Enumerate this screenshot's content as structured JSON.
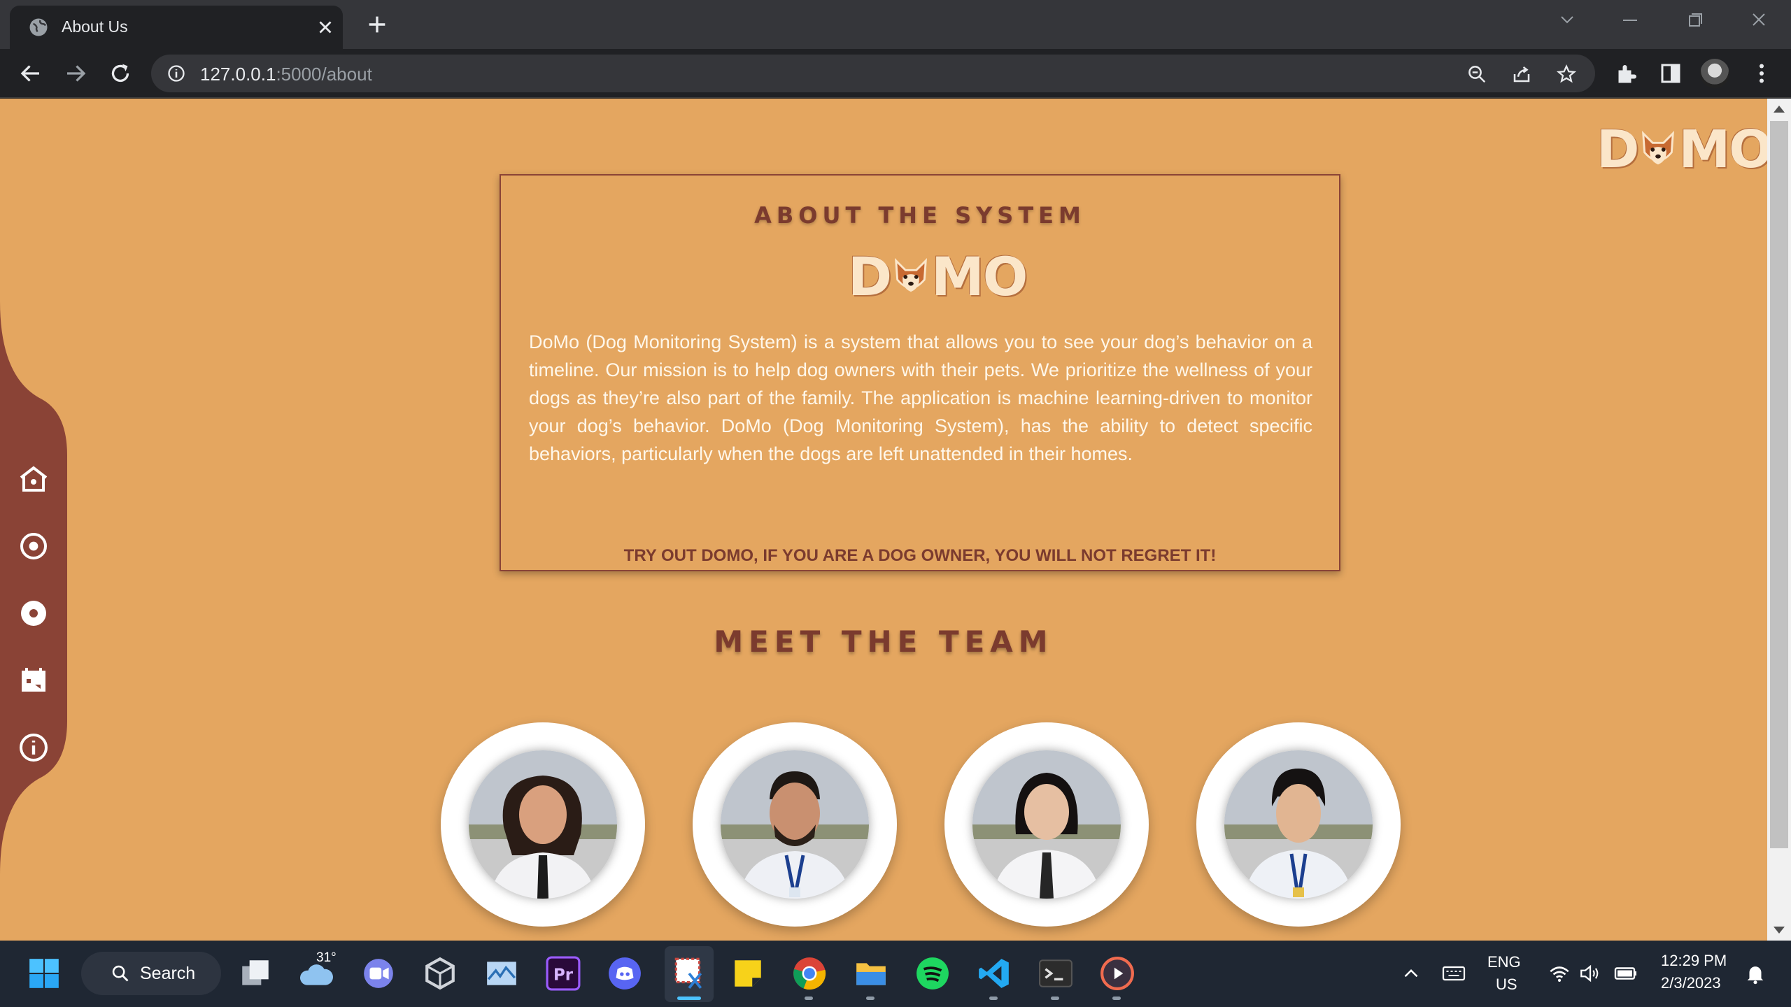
{
  "browser": {
    "tab_title": "About Us",
    "url_host": "127.0.0.1",
    "url_path": ":5000/about"
  },
  "page": {
    "logo_text_left": "D",
    "logo_text_right": "MO",
    "about": {
      "heading": "ABOUT THE SYSTEM",
      "body": "DoMo (Dog Monitoring System) is a system that allows you to see your dog’s behavior on a timeline. Our mission is to help dog owners with their pets. We prioritize the wellness of your dogs as they’re also part of the family. The application is machine learning-driven to monitor your dog’s behavior. DoMo (Dog Monitoring System), has the ability to detect specific behaviors,  particularly when the dogs are left unattended in their homes.",
      "cta": "TRY OUT DOMO, IF YOU ARE A DOG OWNER, YOU WILL NOT REGRET IT!"
    },
    "team_heading": "MEET THE TEAM",
    "sidebar_icons": [
      "home-icon",
      "target-icon",
      "record-icon",
      "calendar-icon",
      "info-icon"
    ]
  },
  "colors": {
    "page_bg": "#e4a660",
    "sidebar_bg": "#8a4336",
    "accent_text": "#7b3b2e"
  },
  "taskbar": {
    "search_label": "Search",
    "weather_temp": "31°",
    "lang_line1": "ENG",
    "lang_line2": "US",
    "time": "12:29 PM",
    "date": "2/3/2023"
  }
}
